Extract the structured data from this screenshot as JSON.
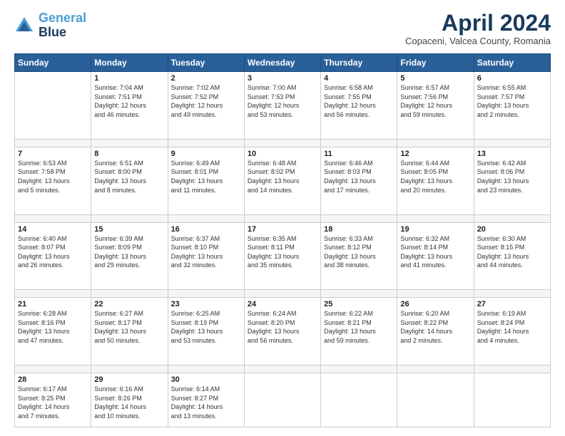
{
  "logo": {
    "line1": "General",
    "line2": "Blue"
  },
  "title": "April 2024",
  "location": "Copaceni, Valcea County, Romania",
  "days_of_week": [
    "Sunday",
    "Monday",
    "Tuesday",
    "Wednesday",
    "Thursday",
    "Friday",
    "Saturday"
  ],
  "weeks": [
    [
      {
        "day": "",
        "info": ""
      },
      {
        "day": "1",
        "info": "Sunrise: 7:04 AM\nSunset: 7:51 PM\nDaylight: 12 hours\nand 46 minutes."
      },
      {
        "day": "2",
        "info": "Sunrise: 7:02 AM\nSunset: 7:52 PM\nDaylight: 12 hours\nand 49 minutes."
      },
      {
        "day": "3",
        "info": "Sunrise: 7:00 AM\nSunset: 7:53 PM\nDaylight: 12 hours\nand 53 minutes."
      },
      {
        "day": "4",
        "info": "Sunrise: 6:58 AM\nSunset: 7:55 PM\nDaylight: 12 hours\nand 56 minutes."
      },
      {
        "day": "5",
        "info": "Sunrise: 6:57 AM\nSunset: 7:56 PM\nDaylight: 12 hours\nand 59 minutes."
      },
      {
        "day": "6",
        "info": "Sunrise: 6:55 AM\nSunset: 7:57 PM\nDaylight: 13 hours\nand 2 minutes."
      }
    ],
    [
      {
        "day": "7",
        "info": "Sunrise: 6:53 AM\nSunset: 7:58 PM\nDaylight: 13 hours\nand 5 minutes."
      },
      {
        "day": "8",
        "info": "Sunrise: 6:51 AM\nSunset: 8:00 PM\nDaylight: 13 hours\nand 8 minutes."
      },
      {
        "day": "9",
        "info": "Sunrise: 6:49 AM\nSunset: 8:01 PM\nDaylight: 13 hours\nand 11 minutes."
      },
      {
        "day": "10",
        "info": "Sunrise: 6:48 AM\nSunset: 8:02 PM\nDaylight: 13 hours\nand 14 minutes."
      },
      {
        "day": "11",
        "info": "Sunrise: 6:46 AM\nSunset: 8:03 PM\nDaylight: 13 hours\nand 17 minutes."
      },
      {
        "day": "12",
        "info": "Sunrise: 6:44 AM\nSunset: 8:05 PM\nDaylight: 13 hours\nand 20 minutes."
      },
      {
        "day": "13",
        "info": "Sunrise: 6:42 AM\nSunset: 8:06 PM\nDaylight: 13 hours\nand 23 minutes."
      }
    ],
    [
      {
        "day": "14",
        "info": "Sunrise: 6:40 AM\nSunset: 8:07 PM\nDaylight: 13 hours\nand 26 minutes."
      },
      {
        "day": "15",
        "info": "Sunrise: 6:39 AM\nSunset: 8:09 PM\nDaylight: 13 hours\nand 29 minutes."
      },
      {
        "day": "16",
        "info": "Sunrise: 6:37 AM\nSunset: 8:10 PM\nDaylight: 13 hours\nand 32 minutes."
      },
      {
        "day": "17",
        "info": "Sunrise: 6:35 AM\nSunset: 8:11 PM\nDaylight: 13 hours\nand 35 minutes."
      },
      {
        "day": "18",
        "info": "Sunrise: 6:33 AM\nSunset: 8:12 PM\nDaylight: 13 hours\nand 38 minutes."
      },
      {
        "day": "19",
        "info": "Sunrise: 6:32 AM\nSunset: 8:14 PM\nDaylight: 13 hours\nand 41 minutes."
      },
      {
        "day": "20",
        "info": "Sunrise: 6:30 AM\nSunset: 8:15 PM\nDaylight: 13 hours\nand 44 minutes."
      }
    ],
    [
      {
        "day": "21",
        "info": "Sunrise: 6:28 AM\nSunset: 8:16 PM\nDaylight: 13 hours\nand 47 minutes."
      },
      {
        "day": "22",
        "info": "Sunrise: 6:27 AM\nSunset: 8:17 PM\nDaylight: 13 hours\nand 50 minutes."
      },
      {
        "day": "23",
        "info": "Sunrise: 6:25 AM\nSunset: 8:19 PM\nDaylight: 13 hours\nand 53 minutes."
      },
      {
        "day": "24",
        "info": "Sunrise: 6:24 AM\nSunset: 8:20 PM\nDaylight: 13 hours\nand 56 minutes."
      },
      {
        "day": "25",
        "info": "Sunrise: 6:22 AM\nSunset: 8:21 PM\nDaylight: 13 hours\nand 59 minutes."
      },
      {
        "day": "26",
        "info": "Sunrise: 6:20 AM\nSunset: 8:22 PM\nDaylight: 14 hours\nand 2 minutes."
      },
      {
        "day": "27",
        "info": "Sunrise: 6:19 AM\nSunset: 8:24 PM\nDaylight: 14 hours\nand 4 minutes."
      }
    ],
    [
      {
        "day": "28",
        "info": "Sunrise: 6:17 AM\nSunset: 8:25 PM\nDaylight: 14 hours\nand 7 minutes."
      },
      {
        "day": "29",
        "info": "Sunrise: 6:16 AM\nSunset: 8:26 PM\nDaylight: 14 hours\nand 10 minutes."
      },
      {
        "day": "30",
        "info": "Sunrise: 6:14 AM\nSunset: 8:27 PM\nDaylight: 14 hours\nand 13 minutes."
      },
      {
        "day": "",
        "info": ""
      },
      {
        "day": "",
        "info": ""
      },
      {
        "day": "",
        "info": ""
      },
      {
        "day": "",
        "info": ""
      }
    ]
  ]
}
